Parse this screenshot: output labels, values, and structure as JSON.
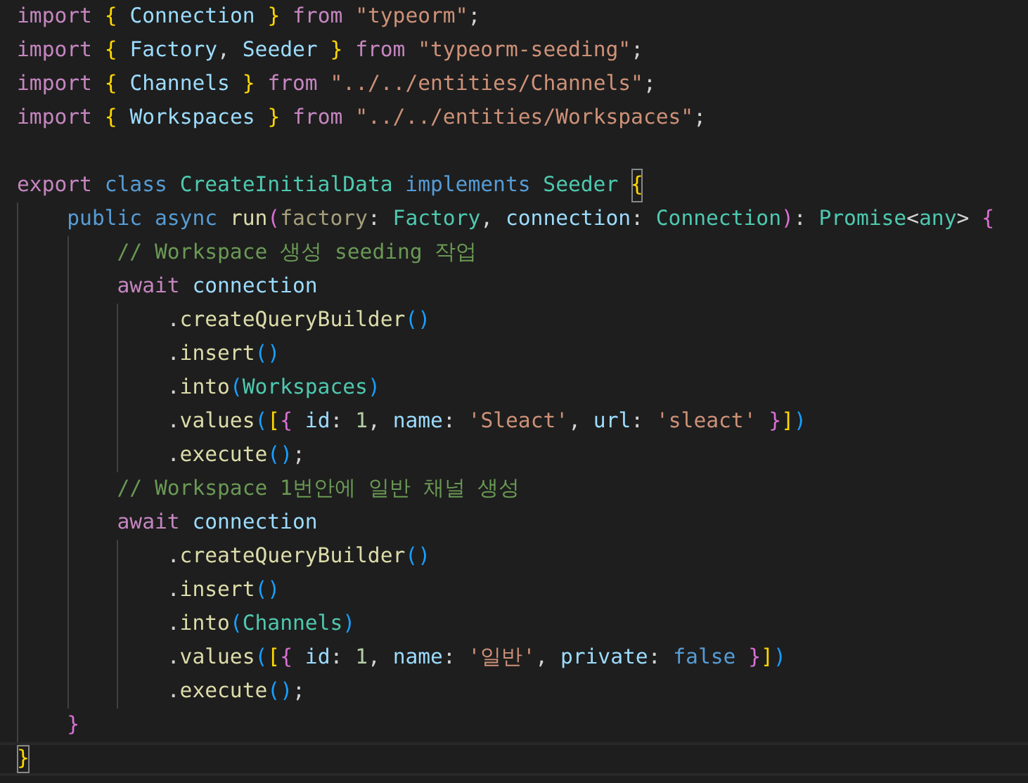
{
  "editor": {
    "lines": [
      {
        "current": false,
        "tokens": [
          {
            "text": "import ",
            "kind": "kw"
          },
          {
            "text": "{ ",
            "kind": "b1"
          },
          {
            "text": "Connection ",
            "kind": "var"
          },
          {
            "text": "} ",
            "kind": "b1"
          },
          {
            "text": "from ",
            "kind": "kw"
          },
          {
            "text": "\"typeorm\"",
            "kind": "str"
          },
          {
            "text": ";",
            "kind": "punct"
          }
        ]
      },
      {
        "current": false,
        "tokens": [
          {
            "text": "import ",
            "kind": "kw"
          },
          {
            "text": "{ ",
            "kind": "b1"
          },
          {
            "text": "Factory",
            "kind": "var"
          },
          {
            "text": ", ",
            "kind": "punct"
          },
          {
            "text": "Seeder ",
            "kind": "var"
          },
          {
            "text": "} ",
            "kind": "b1"
          },
          {
            "text": "from ",
            "kind": "kw"
          },
          {
            "text": "\"typeorm-seeding\"",
            "kind": "str"
          },
          {
            "text": ";",
            "kind": "punct"
          }
        ]
      },
      {
        "current": false,
        "tokens": [
          {
            "text": "import ",
            "kind": "kw"
          },
          {
            "text": "{ ",
            "kind": "b1"
          },
          {
            "text": "Channels ",
            "kind": "var"
          },
          {
            "text": "} ",
            "kind": "b1"
          },
          {
            "text": "from ",
            "kind": "kw"
          },
          {
            "text": "\"../../entities/Channels\"",
            "kind": "str"
          },
          {
            "text": ";",
            "kind": "punct"
          }
        ]
      },
      {
        "current": false,
        "tokens": [
          {
            "text": "import ",
            "kind": "kw"
          },
          {
            "text": "{ ",
            "kind": "b1"
          },
          {
            "text": "Workspaces ",
            "kind": "var"
          },
          {
            "text": "} ",
            "kind": "b1"
          },
          {
            "text": "from ",
            "kind": "kw"
          },
          {
            "text": "\"../../entities/Workspaces\"",
            "kind": "str"
          },
          {
            "text": ";",
            "kind": "punct"
          }
        ],
        "blank_after": true
      },
      {
        "current": false,
        "tokens": [
          {
            "text": "export ",
            "kind": "kw"
          },
          {
            "text": "class ",
            "kind": "storage"
          },
          {
            "text": "CreateInitialData ",
            "kind": "type"
          },
          {
            "text": "implements ",
            "kind": "storage"
          },
          {
            "text": "Seeder ",
            "kind": "type"
          },
          {
            "text": "{",
            "kind": "b1",
            "match": true
          }
        ],
        "children": [
          {
            "current": false,
            "tokens": [
              {
                "text": "public ",
                "kind": "storage"
              },
              {
                "text": "async ",
                "kind": "storage"
              },
              {
                "text": "run",
                "kind": "fn"
              },
              {
                "text": "(",
                "kind": "b2"
              },
              {
                "text": "factory",
                "kind": "dim"
              },
              {
                "text": ": ",
                "kind": "punct"
              },
              {
                "text": "Factory",
                "kind": "type"
              },
              {
                "text": ", ",
                "kind": "punct"
              },
              {
                "text": "connection",
                "kind": "var"
              },
              {
                "text": ": ",
                "kind": "punct"
              },
              {
                "text": "Connection",
                "kind": "type"
              },
              {
                "text": ")",
                "kind": "b2"
              },
              {
                "text": ": ",
                "kind": "punct"
              },
              {
                "text": "Promise",
                "kind": "type"
              },
              {
                "text": "<",
                "kind": "punct"
              },
              {
                "text": "any",
                "kind": "type"
              },
              {
                "text": "> ",
                "kind": "punct"
              },
              {
                "text": "{",
                "kind": "b2"
              }
            ],
            "children": [
              {
                "current": false,
                "tokens": [
                  {
                    "text": "// Workspace 생성 seeding 작업",
                    "kind": "comment"
                  }
                ]
              },
              {
                "current": false,
                "tokens": [
                  {
                    "text": "await ",
                    "kind": "kw"
                  },
                  {
                    "text": "connection",
                    "kind": "var"
                  }
                ],
                "children": [
                  {
                    "current": false,
                    "tokens": [
                      {
                        "text": ".",
                        "kind": "punct"
                      },
                      {
                        "text": "createQueryBuilder",
                        "kind": "fn"
                      },
                      {
                        "text": "()",
                        "kind": "b3"
                      }
                    ]
                  },
                  {
                    "current": false,
                    "tokens": [
                      {
                        "text": ".",
                        "kind": "punct"
                      },
                      {
                        "text": "insert",
                        "kind": "fn"
                      },
                      {
                        "text": "()",
                        "kind": "b3"
                      }
                    ]
                  },
                  {
                    "current": false,
                    "tokens": [
                      {
                        "text": ".",
                        "kind": "punct"
                      },
                      {
                        "text": "into",
                        "kind": "fn"
                      },
                      {
                        "text": "(",
                        "kind": "b3"
                      },
                      {
                        "text": "Workspaces",
                        "kind": "type"
                      },
                      {
                        "text": ")",
                        "kind": "b3"
                      }
                    ]
                  },
                  {
                    "current": false,
                    "tokens": [
                      {
                        "text": ".",
                        "kind": "punct"
                      },
                      {
                        "text": "values",
                        "kind": "fn"
                      },
                      {
                        "text": "(",
                        "kind": "b3"
                      },
                      {
                        "text": "[",
                        "kind": "b1"
                      },
                      {
                        "text": "{ ",
                        "kind": "b2"
                      },
                      {
                        "text": "id",
                        "kind": "var"
                      },
                      {
                        "text": ": ",
                        "kind": "punct"
                      },
                      {
                        "text": "1",
                        "kind": "num"
                      },
                      {
                        "text": ", ",
                        "kind": "punct"
                      },
                      {
                        "text": "name",
                        "kind": "var"
                      },
                      {
                        "text": ": ",
                        "kind": "punct"
                      },
                      {
                        "text": "'Sleact'",
                        "kind": "str"
                      },
                      {
                        "text": ", ",
                        "kind": "punct"
                      },
                      {
                        "text": "url",
                        "kind": "var"
                      },
                      {
                        "text": ": ",
                        "kind": "punct"
                      },
                      {
                        "text": "'sleact' ",
                        "kind": "str"
                      },
                      {
                        "text": "}",
                        "kind": "b2"
                      },
                      {
                        "text": "]",
                        "kind": "b1"
                      },
                      {
                        "text": ")",
                        "kind": "b3"
                      }
                    ]
                  },
                  {
                    "current": false,
                    "tokens": [
                      {
                        "text": ".",
                        "kind": "punct"
                      },
                      {
                        "text": "execute",
                        "kind": "fn"
                      },
                      {
                        "text": "()",
                        "kind": "b3"
                      },
                      {
                        "text": ";",
                        "kind": "punct"
                      }
                    ]
                  }
                ]
              },
              {
                "current": false,
                "tokens": [
                  {
                    "text": "// Workspace 1번안에 일반 채널 생성",
                    "kind": "comment"
                  }
                ]
              },
              {
                "current": false,
                "tokens": [
                  {
                    "text": "await ",
                    "kind": "kw"
                  },
                  {
                    "text": "connection",
                    "kind": "var"
                  }
                ],
                "children": [
                  {
                    "current": false,
                    "tokens": [
                      {
                        "text": ".",
                        "kind": "punct"
                      },
                      {
                        "text": "createQueryBuilder",
                        "kind": "fn"
                      },
                      {
                        "text": "()",
                        "kind": "b3"
                      }
                    ]
                  },
                  {
                    "current": false,
                    "tokens": [
                      {
                        "text": ".",
                        "kind": "punct"
                      },
                      {
                        "text": "insert",
                        "kind": "fn"
                      },
                      {
                        "text": "()",
                        "kind": "b3"
                      }
                    ]
                  },
                  {
                    "current": false,
                    "tokens": [
                      {
                        "text": ".",
                        "kind": "punct"
                      },
                      {
                        "text": "into",
                        "kind": "fn"
                      },
                      {
                        "text": "(",
                        "kind": "b3"
                      },
                      {
                        "text": "Channels",
                        "kind": "type"
                      },
                      {
                        "text": ")",
                        "kind": "b3"
                      }
                    ]
                  },
                  {
                    "current": false,
                    "tokens": [
                      {
                        "text": ".",
                        "kind": "punct"
                      },
                      {
                        "text": "values",
                        "kind": "fn"
                      },
                      {
                        "text": "(",
                        "kind": "b3"
                      },
                      {
                        "text": "[",
                        "kind": "b1"
                      },
                      {
                        "text": "{ ",
                        "kind": "b2"
                      },
                      {
                        "text": "id",
                        "kind": "var"
                      },
                      {
                        "text": ": ",
                        "kind": "punct"
                      },
                      {
                        "text": "1",
                        "kind": "num"
                      },
                      {
                        "text": ", ",
                        "kind": "punct"
                      },
                      {
                        "text": "name",
                        "kind": "var"
                      },
                      {
                        "text": ": ",
                        "kind": "punct"
                      },
                      {
                        "text": "'일반'",
                        "kind": "str"
                      },
                      {
                        "text": ", ",
                        "kind": "punct"
                      },
                      {
                        "text": "private",
                        "kind": "var"
                      },
                      {
                        "text": ": ",
                        "kind": "punct"
                      },
                      {
                        "text": "false ",
                        "kind": "storage"
                      },
                      {
                        "text": "}",
                        "kind": "b2"
                      },
                      {
                        "text": "]",
                        "kind": "b1"
                      },
                      {
                        "text": ")",
                        "kind": "b3"
                      }
                    ]
                  },
                  {
                    "current": false,
                    "tokens": [
                      {
                        "text": ".",
                        "kind": "punct"
                      },
                      {
                        "text": "execute",
                        "kind": "fn"
                      },
                      {
                        "text": "()",
                        "kind": "b3"
                      },
                      {
                        "text": ";",
                        "kind": "punct"
                      }
                    ]
                  }
                ]
              }
            ]
          },
          {
            "current": false,
            "tokens": [
              {
                "text": "}",
                "kind": "b2"
              }
            ]
          }
        ]
      },
      {
        "current": true,
        "tokens": [
          {
            "text": "}",
            "kind": "b1",
            "match": true
          }
        ]
      }
    ]
  }
}
